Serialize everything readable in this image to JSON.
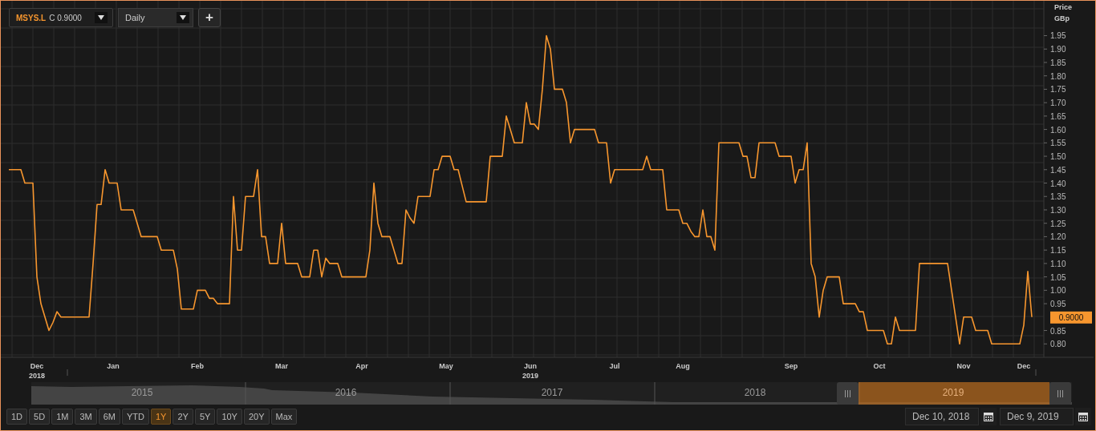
{
  "toolbar": {
    "instrument": {
      "symbol": "MSYS.L",
      "reading": "C 0.9000"
    },
    "interval": "Daily",
    "add_button": "+"
  },
  "chart": {
    "axis_title": [
      "Price",
      "GBp"
    ],
    "last_price": "0.9000",
    "chart_data": {
      "type": "line",
      "grid": true,
      "ylim": [
        0.75,
        2.08
      ],
      "yticks": [
        {
          "value": 0.8,
          "label": "0.80"
        },
        {
          "value": 0.85,
          "label": "0.85"
        },
        {
          "value": 0.95,
          "label": "0.95"
        },
        {
          "value": 1.0,
          "label": "1.00"
        },
        {
          "value": 1.05,
          "label": "1.05"
        },
        {
          "value": 1.1,
          "label": "1.10"
        },
        {
          "value": 1.15,
          "label": "1.15"
        },
        {
          "value": 1.2,
          "label": "1.20"
        },
        {
          "value": 1.25,
          "label": "1.25"
        },
        {
          "value": 1.3,
          "label": "1.30"
        },
        {
          "value": 1.35,
          "label": "1.35"
        },
        {
          "value": 1.4,
          "label": "1.40"
        },
        {
          "value": 1.45,
          "label": "1.45"
        },
        {
          "value": 1.5,
          "label": "1.50"
        },
        {
          "value": 1.55,
          "label": "1.55"
        },
        {
          "value": 1.6,
          "label": "1.60"
        },
        {
          "value": 1.65,
          "label": "1.65"
        },
        {
          "value": 1.7,
          "label": "1.70"
        },
        {
          "value": 1.75,
          "label": "1.75"
        },
        {
          "value": 1.8,
          "label": "1.80"
        },
        {
          "value": 1.85,
          "label": "1.85"
        },
        {
          "value": 1.9,
          "label": "1.90"
        },
        {
          "value": 1.95,
          "label": "1.95"
        }
      ],
      "categories": [
        null,
        null,
        null,
        null,
        null,
        null,
        null,
        "Dec 2018",
        null,
        null,
        null,
        null,
        null,
        null,
        null,
        null,
        null,
        null,
        null,
        null,
        null,
        null,
        null,
        null,
        null,
        null,
        "Jan",
        null,
        null,
        null,
        null,
        null,
        null,
        null,
        null,
        null,
        null,
        null,
        null,
        null,
        null,
        null,
        null,
        null,
        null,
        null,
        null,
        "Feb",
        null,
        null,
        null,
        null,
        null,
        null,
        null,
        null,
        null,
        null,
        null,
        null,
        null,
        null,
        null,
        null,
        null,
        null,
        null,
        null,
        "Mar",
        null,
        null,
        null,
        null,
        null,
        null,
        null,
        null,
        null,
        null,
        null,
        null,
        null,
        null,
        null,
        null,
        null,
        null,
        null,
        "Apr",
        null,
        null,
        null,
        null,
        null,
        null,
        null,
        null,
        null,
        null,
        null,
        null,
        null,
        null,
        null,
        null,
        null,
        null,
        null,
        null,
        "May",
        null,
        null,
        null,
        null,
        null,
        null,
        null,
        null,
        null,
        null,
        null,
        null,
        null,
        null,
        null,
        null,
        null,
        null,
        null,
        null,
        "Jun 2019",
        null,
        null,
        null,
        null,
        null,
        null,
        null,
        null,
        null,
        null,
        null,
        null,
        null,
        null,
        null,
        null,
        null,
        null,
        null,
        null,
        "Jul",
        null,
        null,
        null,
        null,
        null,
        null,
        null,
        null,
        null,
        null,
        null,
        null,
        null,
        null,
        null,
        null,
        "Aug",
        null,
        null,
        null,
        null,
        null,
        null,
        null,
        null,
        null,
        null,
        null,
        null,
        null,
        null,
        null,
        null,
        null,
        null,
        null,
        null,
        null,
        null,
        null,
        null,
        null,
        null,
        "Sep",
        null,
        null,
        null,
        null,
        null,
        null,
        null,
        null,
        null,
        null,
        null,
        null,
        null,
        null,
        null,
        null,
        null,
        null,
        null,
        null,
        null,
        "Oct",
        null,
        null,
        null,
        null,
        null,
        null,
        null,
        null,
        null,
        null,
        null,
        null,
        null,
        null,
        null,
        null,
        null,
        null,
        null,
        null,
        "Nov",
        null,
        null,
        null,
        null,
        null,
        null,
        null,
        null,
        null,
        null,
        null,
        null,
        null,
        null,
        "Dec",
        null,
        null
      ],
      "series": [
        {
          "color": "#f7962e",
          "values": [
            1.45,
            1.45,
            1.45,
            1.45,
            1.4,
            1.4,
            1.4,
            1.05,
            0.95,
            0.9,
            0.85,
            0.88,
            0.92,
            0.9,
            0.9,
            0.9,
            0.9,
            0.9,
            0.9,
            0.9,
            0.9,
            1.1,
            1.32,
            1.32,
            1.45,
            1.4,
            1.4,
            1.4,
            1.3,
            1.3,
            1.3,
            1.3,
            1.25,
            1.2,
            1.2,
            1.2,
            1.2,
            1.2,
            1.15,
            1.15,
            1.15,
            1.15,
            1.08,
            0.93,
            0.93,
            0.93,
            0.93,
            1.0,
            1.0,
            1.0,
            0.97,
            0.97,
            0.95,
            0.95,
            0.95,
            0.95,
            1.35,
            1.15,
            1.15,
            1.35,
            1.35,
            1.35,
            1.45,
            1.2,
            1.2,
            1.1,
            1.1,
            1.1,
            1.25,
            1.1,
            1.1,
            1.1,
            1.1,
            1.05,
            1.05,
            1.05,
            1.15,
            1.15,
            1.05,
            1.12,
            1.1,
            1.1,
            1.1,
            1.05,
            1.05,
            1.05,
            1.05,
            1.05,
            1.05,
            1.05,
            1.15,
            1.4,
            1.25,
            1.2,
            1.2,
            1.2,
            1.15,
            1.1,
            1.1,
            1.3,
            1.27,
            1.25,
            1.35,
            1.35,
            1.35,
            1.35,
            1.45,
            1.45,
            1.5,
            1.5,
            1.5,
            1.45,
            1.45,
            1.39,
            1.33,
            1.33,
            1.33,
            1.33,
            1.33,
            1.33,
            1.5,
            1.5,
            1.5,
            1.5,
            1.65,
            1.6,
            1.55,
            1.55,
            1.55,
            1.7,
            1.62,
            1.62,
            1.6,
            1.75,
            1.95,
            1.9,
            1.75,
            1.75,
            1.75,
            1.7,
            1.55,
            1.6,
            1.6,
            1.6,
            1.6,
            1.6,
            1.6,
            1.55,
            1.55,
            1.55,
            1.4,
            1.45,
            1.45,
            1.45,
            1.45,
            1.45,
            1.45,
            1.45,
            1.45,
            1.5,
            1.45,
            1.45,
            1.45,
            1.45,
            1.3,
            1.3,
            1.3,
            1.3,
            1.25,
            1.25,
            1.22,
            1.2,
            1.2,
            1.3,
            1.2,
            1.2,
            1.15,
            1.55,
            1.55,
            1.55,
            1.55,
            1.55,
            1.55,
            1.5,
            1.5,
            1.42,
            1.42,
            1.55,
            1.55,
            1.55,
            1.55,
            1.55,
            1.5,
            1.5,
            1.5,
            1.5,
            1.4,
            1.45,
            1.45,
            1.55,
            1.1,
            1.05,
            0.9,
            1.0,
            1.05,
            1.05,
            1.05,
            1.05,
            0.95,
            0.95,
            0.95,
            0.95,
            0.92,
            0.92,
            0.85,
            0.85,
            0.85,
            0.85,
            0.85,
            0.8,
            0.8,
            0.9,
            0.85,
            0.85,
            0.85,
            0.85,
            0.85,
            1.1,
            1.1,
            1.1,
            1.1,
            1.1,
            1.1,
            1.1,
            1.1,
            1.0,
            0.9,
            0.8,
            0.9,
            0.9,
            0.9,
            0.85,
            0.85,
            0.85,
            0.85,
            0.8,
            0.8,
            0.8,
            0.8,
            0.8,
            0.8,
            0.8,
            0.8,
            0.87,
            1.07,
            0.9
          ]
        }
      ]
    }
  },
  "navigator": {
    "years": [
      {
        "label": "2015",
        "selected": false
      },
      {
        "label": "2016",
        "selected": false
      },
      {
        "label": "2017",
        "selected": false
      },
      {
        "label": "2018",
        "selected": false
      },
      {
        "label": "2019",
        "selected": true
      }
    ]
  },
  "ranges": [
    {
      "label": "1D",
      "selected": false
    },
    {
      "label": "5D",
      "selected": false
    },
    {
      "label": "1M",
      "selected": false
    },
    {
      "label": "3M",
      "selected": false
    },
    {
      "label": "6M",
      "selected": false
    },
    {
      "label": "YTD",
      "selected": false
    },
    {
      "label": "1Y",
      "selected": true
    },
    {
      "label": "2Y",
      "selected": false
    },
    {
      "label": "5Y",
      "selected": false
    },
    {
      "label": "10Y",
      "selected": false
    },
    {
      "label": "20Y",
      "selected": false
    },
    {
      "label": "Max",
      "selected": false
    }
  ],
  "date_range": {
    "start": "Dec 10, 2018",
    "end": "Dec 9, 2019"
  }
}
